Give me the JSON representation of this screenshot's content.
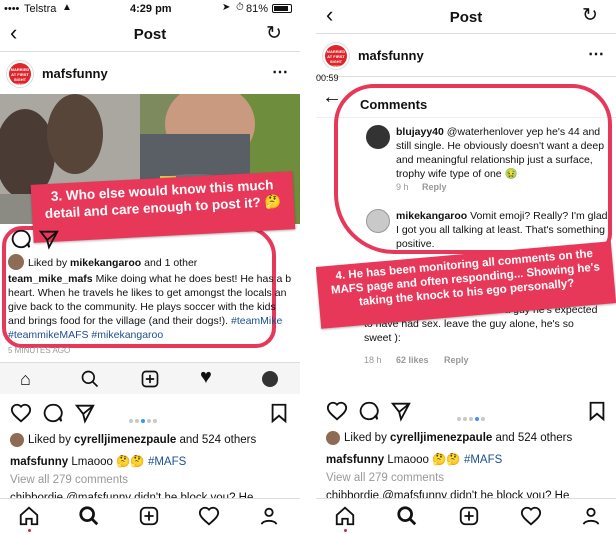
{
  "left": {
    "status": {
      "carrier": "Telstra",
      "time": "4:29 pm",
      "battery": "81%"
    },
    "nav": {
      "title": "Post"
    },
    "post": {
      "username": "mafsfunny",
      "logo_text": "MARRIED AT FIRST SIGHT FUNNY",
      "annotation": "3. Who else would know this much detail and care enough to post it? 🤔",
      "liked_by_prefix": "Liked by ",
      "liked_by_user": "mikekangaroo",
      "liked_by_suffix": " and 1 other",
      "caption_user": "team_mike_mafs",
      "caption": "Mike doing what he does best! He has a b heart. When he travels he likes to get amongst the locals an give back to the community. He plays soccer with the kids and brings food for the village (and their dogs!).",
      "hashtags": "#teamMike #teammikeMAFS #mikekangaroo",
      "time_ago": "5 MINUTES AGO"
    },
    "feed": {
      "liked_by_prefix": "Liked by ",
      "liked_by_user": "cyrelljimenezpaule",
      "liked_by_suffix": " and 524 others",
      "caption_user": "mafsfunny",
      "caption": " Lmaooo 🤔🤔 ",
      "hashtag": "#MAFS",
      "view_comments": "View all 279 comments",
      "next_comment": "chibbordie @mafsfunny didn't he block you? He"
    }
  },
  "right": {
    "nav": {
      "title": "Post"
    },
    "post": {
      "username": "mafsfunny",
      "logo_text": "MARRIED AT FIRST SIGHT FUNNY"
    },
    "comments_header": {
      "title": "Comments",
      "obscured_time": "00:59"
    },
    "comments": [
      {
        "user": "blujayy40",
        "text": " @waterhenlover yep he's 44 and still single.  He obviously doesn't want a deep and meaningful relationship just a surface, trophy wife type of one 🤢",
        "time": "9 h",
        "reply": "Reply"
      },
      {
        "user": "mikekangaroo",
        "text": " Vomit emoji? Really? I'm glad I got you all talking at least. That's something positive.",
        "likes": "likes"
      },
      {
        "text": "referring to ... was a woman who was a virgin it w... big deal but because he's a guy he's expected to have had sex. leave the guy alone, he's so sweet ):",
        "time": "18 h",
        "likes": "62 likes",
        "reply": "Reply"
      }
    ],
    "annotation": "4. He has been monitoring all comments on the MAFS page and often responding... Showing he's taking the knock to his ego personally?",
    "feed": {
      "liked_by_prefix": "Liked by ",
      "liked_by_user": "cyrelljimenezpaule",
      "liked_by_suffix": " and 524 others",
      "caption_user": "mafsfunny",
      "caption": " Lmaooo 🤔🤔 ",
      "hashtag": "#MAFS",
      "view_comments": "View all 279 comments",
      "next_comment": "chibbordie @mafsfunny didn't he block you? He"
    }
  },
  "colors": {
    "annotation": "#e8385a",
    "link": "#1d4f91",
    "accent_blue": "#3897f0"
  }
}
